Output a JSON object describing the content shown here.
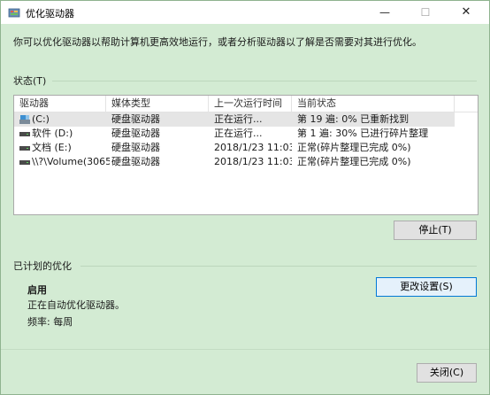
{
  "window": {
    "title": "优化驱动器"
  },
  "description": "你可以优化驱动器以帮助计算机更高效地运行，或者分析驱动器以了解是否需要对其进行优化。",
  "status_section": {
    "label": "状态(T)",
    "columns": [
      "驱动器",
      "媒体类型",
      "上一次运行时间",
      "当前状态"
    ],
    "rows": [
      {
        "drive": "(C:)",
        "media": "硬盘驱动器",
        "last_run": "正在运行...",
        "status": "第 19 遍: 0% 已重新找到",
        "icon": "system-drive-icon",
        "selected": true
      },
      {
        "drive": "软件 (D:)",
        "media": "硬盘驱动器",
        "last_run": "正在运行...",
        "status": "第 1 遍: 30% 已进行碎片整理",
        "icon": "drive-icon",
        "selected": false
      },
      {
        "drive": "文档 (E:)",
        "media": "硬盘驱动器",
        "last_run": "2018/1/23 11:03",
        "status": "正常(碎片整理已完成 0%)",
        "icon": "drive-icon",
        "selected": false
      },
      {
        "drive": "\\\\?\\Volume(3065...",
        "media": "硬盘驱动器",
        "last_run": "2018/1/23 11:03",
        "status": "正常(碎片整理已完成 0%)",
        "icon": "drive-icon",
        "selected": false
      }
    ],
    "stop_button": "停止(T)"
  },
  "scheduled_section": {
    "label": "已计划的优化",
    "state": "启用",
    "detail": "正在自动优化驱动器。",
    "frequency": "频率: 每周",
    "change_settings_button": "更改设置(S)"
  },
  "close_button": "关闭(C)",
  "colors": {
    "background": "#d3ebd3",
    "accent": "#0078d7"
  }
}
